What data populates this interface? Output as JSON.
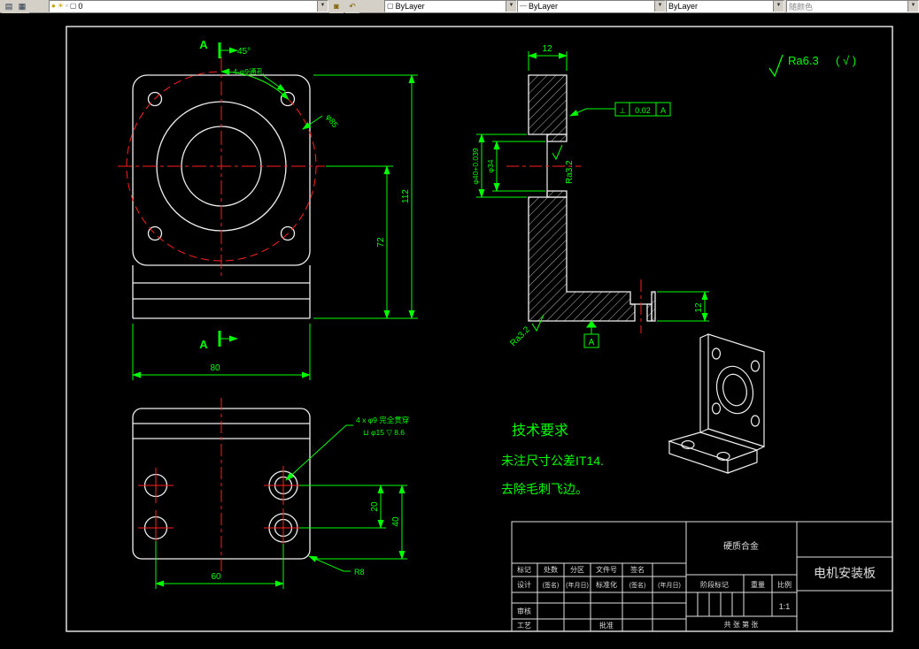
{
  "toolbar": {
    "layer_value": "0",
    "color_value": "ByLayer",
    "linetype_value": "ByLayer",
    "lineweight_value": "ByLayer",
    "plotstyle_value": "随颜色"
  },
  "icons": {
    "layer_properties": "▤",
    "layer_states": "▦",
    "bulb": "●",
    "sun": "☀",
    "lock": "▫",
    "color_chip": "▢",
    "make_current": "◙",
    "layer_previous": "↶",
    "dropdown_arrow": "▼",
    "linetype_preview": "—"
  },
  "drawing": {
    "roughness": {
      "value": "Ra6.3",
      "others": "( √ )"
    },
    "tech_requirements": {
      "title": "技术要求",
      "line1": "未注尺寸公差IT14.",
      "line2": "去除毛刺飞边。"
    },
    "front_view": {
      "section_label_top": "A",
      "section_label_bottom": "A",
      "angle_dim": "45°",
      "holes_note": "4-φ9通孔",
      "bolt_circle_dim": "φ85",
      "dim_width": "80",
      "dim_center_height": "72",
      "dim_total_height": "112"
    },
    "section_view": {
      "dim_flange_thickness": "12",
      "dim_bore": "φ40+0.039",
      "dim_bore_inner": "φ34",
      "ra_bore": "Ra3.2",
      "ra_bottom": "Ra3.2",
      "fcf_symbol": "⊥",
      "fcf_tolerance": "0.02",
      "fcf_datum": "A",
      "datum_label": "A",
      "dim_base_thickness": "12"
    },
    "bottom_view": {
      "hole_callout_line1": "4 x φ9 完全贯穿",
      "hole_callout_line2": "⊔ φ15 ▽ 8.6",
      "dim_hole_spacing": "20",
      "dim_edge": "40",
      "dim_width": "60",
      "fillet_note": "R8"
    },
    "title_block": {
      "material": "硬质合金",
      "part_name": "电机安装板",
      "header_cells": [
        "标记",
        "处数",
        "分区",
        "文件号",
        "签名"
      ],
      "design_row": [
        "设计",
        "(签名)",
        "(年月日)",
        "标准化",
        "(签名)",
        "(年月日)"
      ],
      "review_label": "审核",
      "craft_label": "工艺",
      "approve_label": "批准",
      "stage_label": "阶段标记",
      "weight_label": "重量",
      "scale_label": "比例",
      "scale_value": "1:1",
      "sheet_info": "共  张  第  张"
    }
  }
}
